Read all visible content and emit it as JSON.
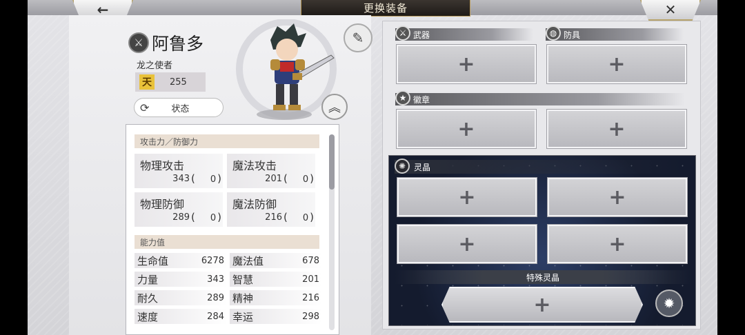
{
  "header": {
    "title": "更换装备",
    "back_icon": "←",
    "close_icon": "✕"
  },
  "hero": {
    "name": "阿鲁多",
    "title": "龙之使者",
    "rank_icon_text": "天",
    "rank_value": "255",
    "status_button": "状态",
    "refresh_icon": "⟳",
    "memo_icon": "✎",
    "up_icon": "︽",
    "weapon_icon": "⚔"
  },
  "stats": {
    "attack_defense_header": "攻击力／防御力",
    "cards": [
      {
        "label": "物理攻击",
        "value": "343",
        "bonus": "0"
      },
      {
        "label": "魔法攻击",
        "value": "201",
        "bonus": "0"
      },
      {
        "label": "物理防御",
        "value": "289",
        "bonus": "0"
      },
      {
        "label": "魔法防御",
        "value": "216",
        "bonus": "0"
      }
    ],
    "ability_header": "能力值",
    "abilities": [
      {
        "label": "生命值",
        "value": "6278"
      },
      {
        "label": "魔法值",
        "value": "678"
      },
      {
        "label": "力量",
        "value": "343"
      },
      {
        "label": "智慧",
        "value": "201"
      },
      {
        "label": "耐久",
        "value": "289"
      },
      {
        "label": "精神",
        "value": "216"
      },
      {
        "label": "速度",
        "value": "284"
      },
      {
        "label": "幸运",
        "value": "298"
      }
    ]
  },
  "equipment": {
    "weapon_label": "武器",
    "armor_label": "防具",
    "emblem_label": "徽章",
    "crystal_label": "灵晶",
    "special_crystal_label": "特殊灵晶",
    "add_symbol": "+",
    "weapon_icon": "⚔",
    "armor_icon": "◍",
    "emblem_icon": "★",
    "crystal_icon": "✺",
    "sparkle_icon": "✹"
  },
  "colors": {
    "title_plate": "#2a2420",
    "gold_border": "#b89a5a",
    "crystal_panel": "#1c2540"
  }
}
